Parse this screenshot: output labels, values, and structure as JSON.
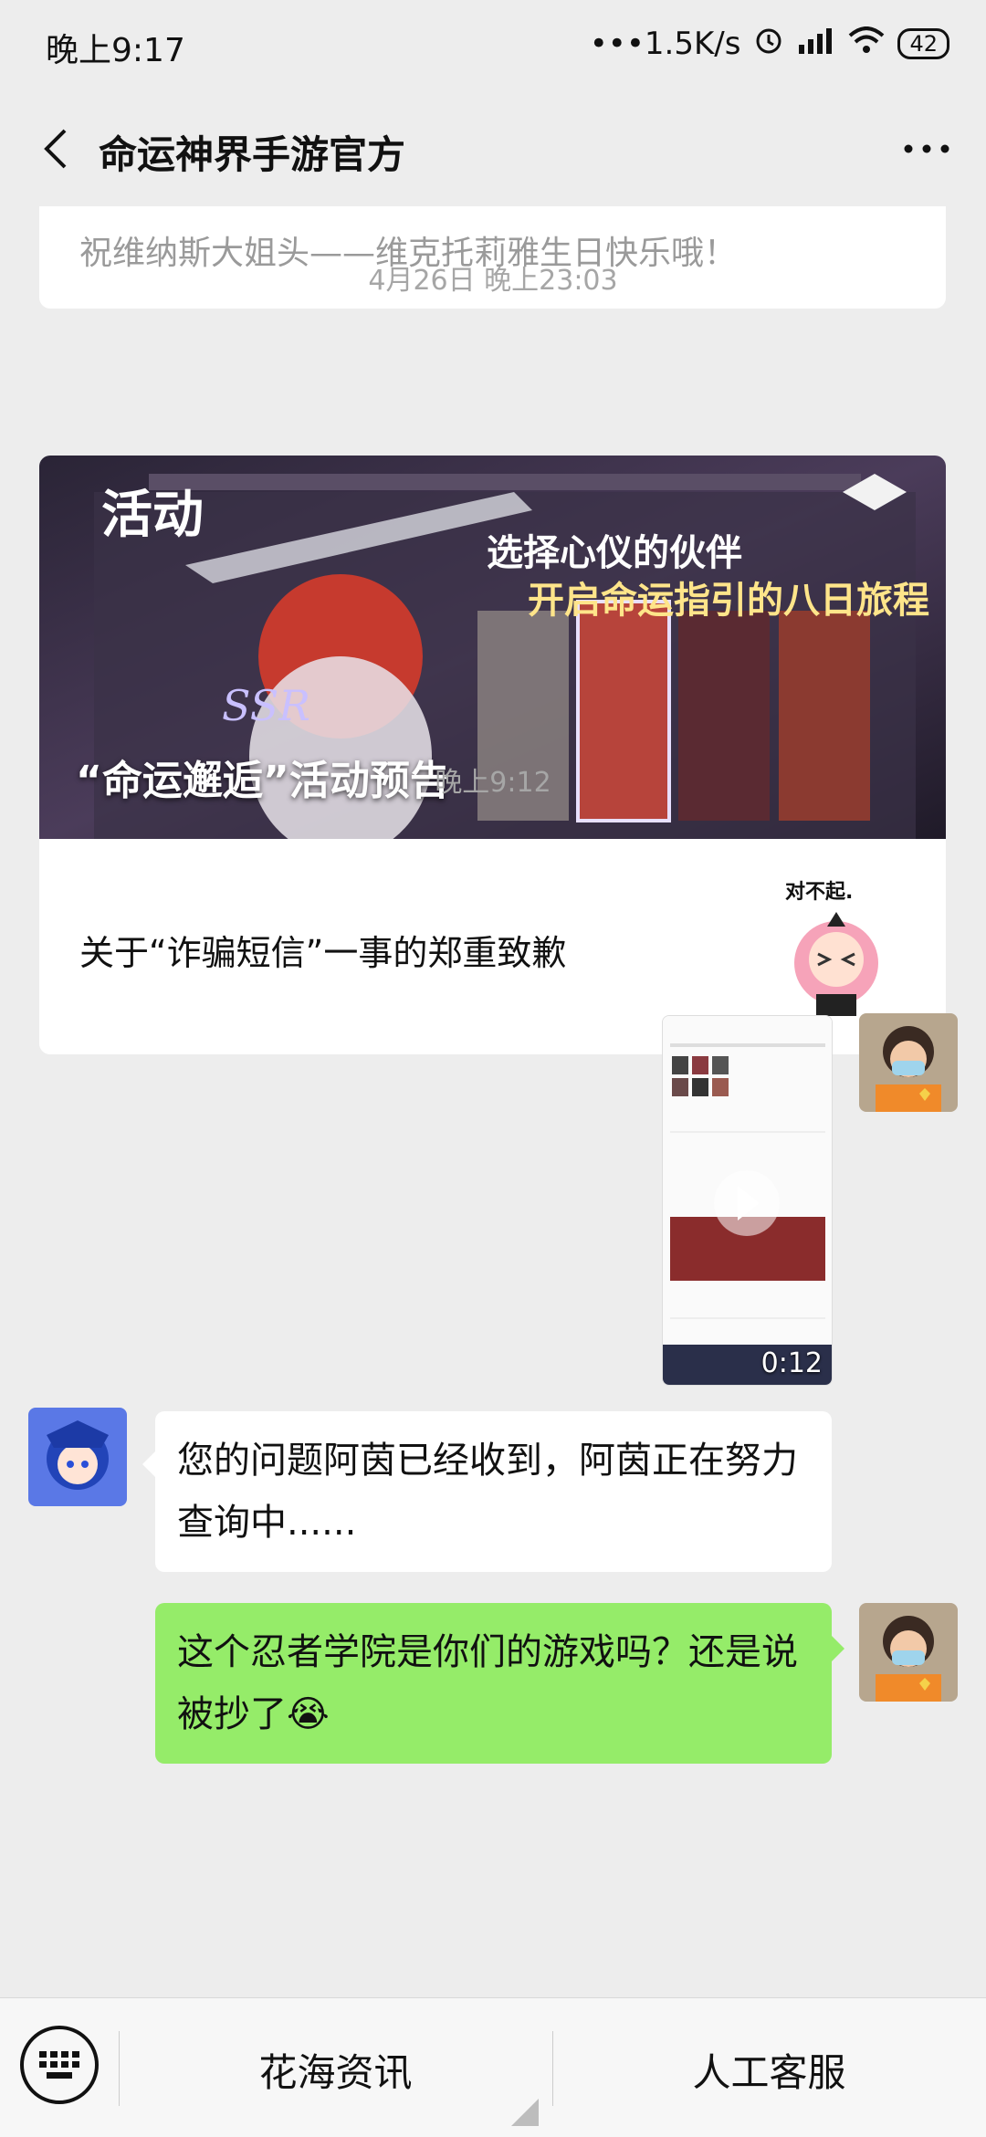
{
  "status_bar": {
    "time": "晚上9:17",
    "network_speed": "•••1.5K/s",
    "battery": "42",
    "icons": [
      "alarm-icon",
      "signal-icon",
      "wifi-icon",
      "battery-icon"
    ]
  },
  "nav": {
    "title": "命运神界手游官方",
    "back_icon": "chevron-left-icon",
    "more_icon": "more-dots-icon"
  },
  "messages": {
    "prev_card_text": "祝维纳斯大姐头——维克托莉雅生日快乐哦！",
    "timestamp_1": "4月26日 晚上23:03",
    "article_card": {
      "banner_tag": "活动",
      "banner_caption": "“命运邂逅”活动预告",
      "second_title": "关于“诈骗短信”一事的郑重致歉",
      "sticker_text": "对不起."
    },
    "timestamp_2": "晚上9:12",
    "video": {
      "duration": "0:12"
    },
    "reply_text": "您的问题阿茵已经收到，阿茵正在努力查询中......",
    "user_text": "这个忍者学院是你们的游戏吗？还是说被抄了😭"
  },
  "bottom_menu": {
    "keyboard_icon": "keyboard-icon",
    "item_1": "花海资讯",
    "item_2": "人工客服"
  },
  "colors": {
    "background": "#ededed",
    "bubble_green": "#95ec69",
    "bubble_white": "#ffffff"
  }
}
